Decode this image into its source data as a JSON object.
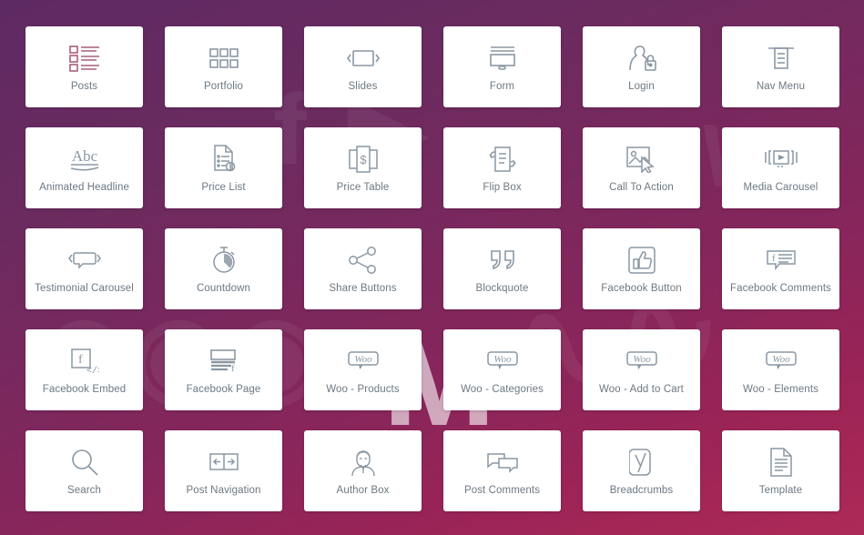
{
  "panel": {
    "title": "Elementor Pro Widgets Panel",
    "background_gradient_from": "#5e2a63",
    "background_gradient_to": "#ad2a57",
    "card_background": "#ffffff",
    "label_color": "#6d7882",
    "icon_color": "#8a97a3",
    "active_icon_color": "#a85f7c"
  },
  "watermarks": [
    "f",
    "▶",
    "W",
    "M",
    "↗",
    "f"
  ],
  "widgets": [
    {
      "label": "Posts",
      "icon": "posts-icon",
      "active": true
    },
    {
      "label": "Portfolio",
      "icon": "portfolio-grid-icon",
      "active": false
    },
    {
      "label": "Slides",
      "icon": "slides-icon",
      "active": false
    },
    {
      "label": "Form",
      "icon": "form-icon",
      "active": false
    },
    {
      "label": "Login",
      "icon": "login-lock-icon",
      "active": false
    },
    {
      "label": "Nav Menu",
      "icon": "nav-menu-icon",
      "active": false
    },
    {
      "label": "Animated Headline",
      "icon": "animated-headline-abc-icon",
      "active": false
    },
    {
      "label": "Price List",
      "icon": "price-list-icon",
      "active": false
    },
    {
      "label": "Price Table",
      "icon": "price-table-icon",
      "active": false
    },
    {
      "label": "Flip Box",
      "icon": "flip-box-icon",
      "active": false
    },
    {
      "label": "Call To Action",
      "icon": "call-to-action-cursor-icon",
      "active": false
    },
    {
      "label": "Media Carousel",
      "icon": "media-carousel-icon",
      "active": false
    },
    {
      "label": "Testimonial Carousel",
      "icon": "testimonial-carousel-icon",
      "active": false
    },
    {
      "label": "Countdown",
      "icon": "countdown-stopwatch-icon",
      "active": false
    },
    {
      "label": "Share Buttons",
      "icon": "share-buttons-icon",
      "active": false
    },
    {
      "label": "Blockquote",
      "icon": "blockquote-icon",
      "active": false
    },
    {
      "label": "Facebook Button",
      "icon": "facebook-thumbs-up-icon",
      "active": false
    },
    {
      "label": "Facebook Comments",
      "icon": "facebook-comments-icon",
      "active": false
    },
    {
      "label": "Facebook Embed",
      "icon": "facebook-embed-code-icon",
      "active": false
    },
    {
      "label": "Facebook Page",
      "icon": "facebook-page-icon",
      "active": false
    },
    {
      "label": "Woo - Products",
      "icon": "woo-icon",
      "active": false
    },
    {
      "label": "Woo - Categories",
      "icon": "woo-icon",
      "active": false
    },
    {
      "label": "Woo - Add to Cart",
      "icon": "woo-icon",
      "active": false
    },
    {
      "label": "Woo - Elements",
      "icon": "woo-icon",
      "active": false
    },
    {
      "label": "Search",
      "icon": "search-magnifier-icon",
      "active": false
    },
    {
      "label": "Post Navigation",
      "icon": "post-navigation-icon",
      "active": false
    },
    {
      "label": "Author Box",
      "icon": "author-box-person-icon",
      "active": false
    },
    {
      "label": "Post Comments",
      "icon": "post-comments-icon",
      "active": false
    },
    {
      "label": "Breadcrumbs",
      "icon": "yoast-breadcrumbs-icon",
      "active": false
    },
    {
      "label": "Template",
      "icon": "template-document-icon",
      "active": false
    }
  ]
}
